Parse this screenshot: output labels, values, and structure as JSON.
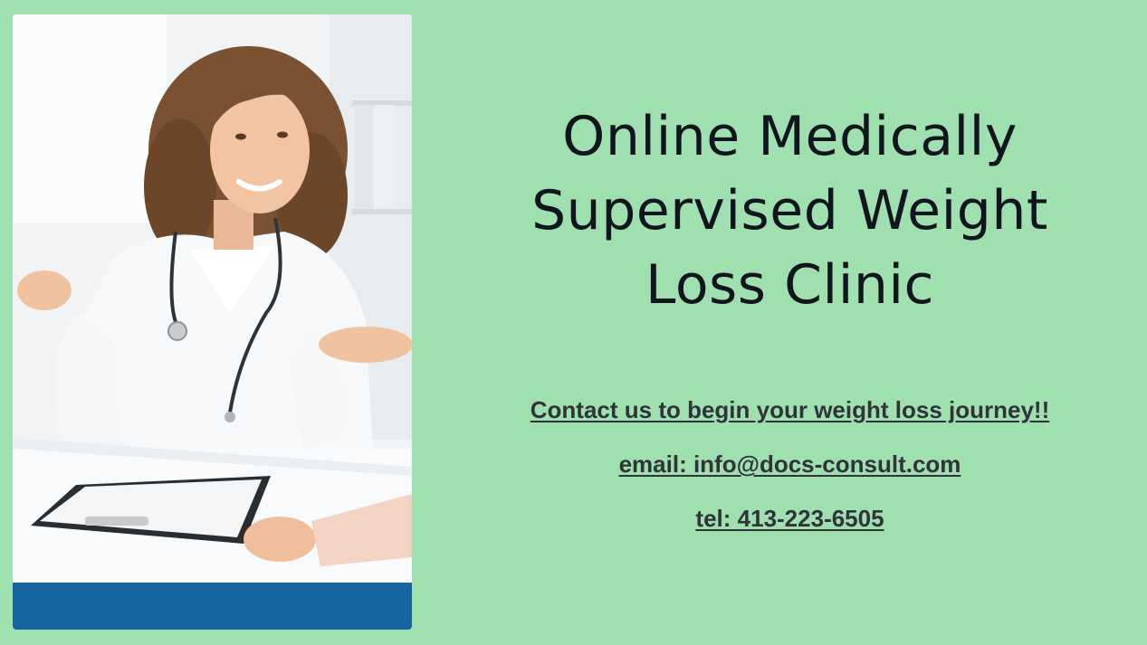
{
  "slide": {
    "background_color": "#a0e0b0",
    "headline_lines": [
      "Online Medically",
      "Supervised Weight",
      "Loss Clinic"
    ],
    "contact": {
      "cta": "Contact us to begin your weight loss journey!!",
      "email": "email: info@docs-consult.com",
      "phone": "tel: 413-223-6505"
    }
  },
  "photo": {
    "subject": "smiling doctor in white coat with stethoscope at desk with clipboard",
    "footer_band_color": "#1565a0"
  }
}
